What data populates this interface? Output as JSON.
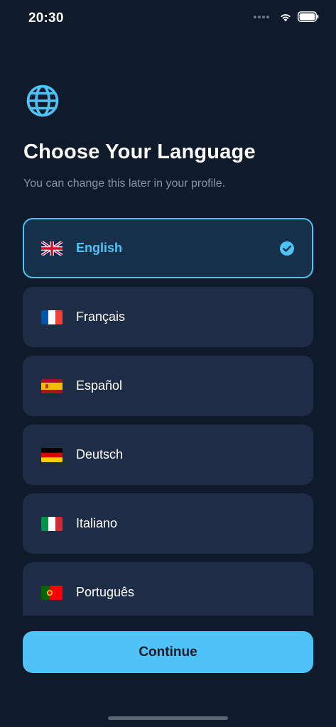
{
  "status_bar": {
    "time": "20:30"
  },
  "header": {
    "title": "Choose Your Language",
    "subtitle": "You can change this later in your profile."
  },
  "languages": [
    {
      "label": "English",
      "flag": "uk-flag-icon",
      "selected": true
    },
    {
      "label": "Français",
      "flag": "france-flag-icon",
      "selected": false
    },
    {
      "label": "Español",
      "flag": "spain-flag-icon",
      "selected": false
    },
    {
      "label": "Deutsch",
      "flag": "germany-flag-icon",
      "selected": false
    },
    {
      "label": "Italiano",
      "flag": "italy-flag-icon",
      "selected": false
    },
    {
      "label": "Português",
      "flag": "portugal-flag-icon",
      "selected": false
    }
  ],
  "actions": {
    "continue_label": "Continue"
  },
  "colors": {
    "background": "#0f1a2b",
    "card": "#1e2d45",
    "selected_card": "#17304a",
    "accent": "#4fc3f7",
    "subtitle": "#8893a4"
  }
}
